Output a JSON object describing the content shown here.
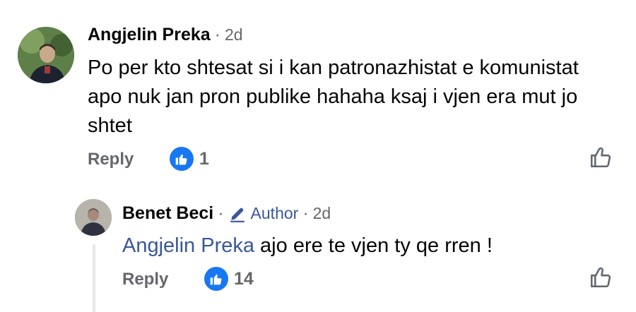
{
  "comments": [
    {
      "author": "Angjelin Preka",
      "time": "2d",
      "text": "Po per kto shtesat si i kan patronazhistat e komunistat apo nuk jan pron publike hahaha ksaj i vjen era mut jo shtet",
      "reply_label": "Reply",
      "reaction_count": "1",
      "reaction_icon": "like-icon"
    }
  ],
  "replies": [
    {
      "author": "Benet Beci",
      "badge": "Author",
      "badge_icon": "pencil-icon",
      "time": "2d",
      "mention": "Angjelin Preka",
      "text": " ajo ere te vjen ty qe rren !",
      "reply_label": "Reply",
      "reaction_count": "14",
      "reaction_icon": "like-icon"
    }
  ],
  "separator": "·",
  "colors": {
    "link": "#385898",
    "like_blue": "#1877f2",
    "secondary_text": "#65676b"
  }
}
